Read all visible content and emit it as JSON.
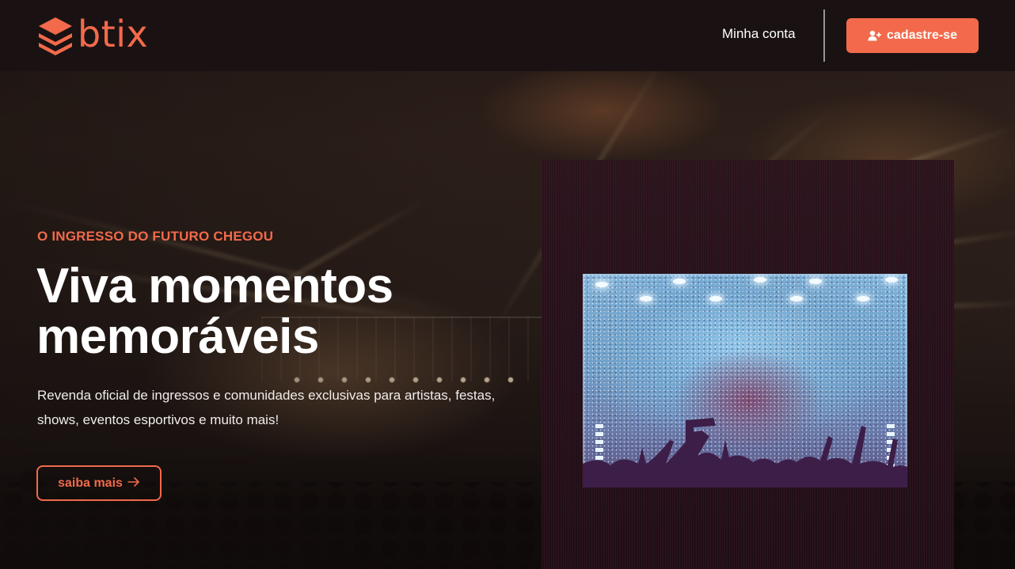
{
  "navbar": {
    "logo_text": "btix",
    "account_link": "Minha conta",
    "signup_label": "cadastre-se"
  },
  "hero": {
    "eyebrow": "O INGRESSO DO FUTURO CHEGOU",
    "headline_line1": "Viva momentos",
    "headline_line2": "memoráveis",
    "description": "Revenda oficial de ingressos e comunidades exclusivas para artistas, festas, shows, eventos esportivos e muito mais!",
    "cta_label": "saiba mais"
  },
  "icons": {
    "logo": "stacked-layers-icon",
    "signup": "user-plus-icon",
    "cta": "arrow-right-icon"
  },
  "colors": {
    "accent": "#f26a4b",
    "navbar_bg": "#1a1212",
    "text_primary": "#ffffff",
    "media_panel_bg": "#25111a"
  }
}
